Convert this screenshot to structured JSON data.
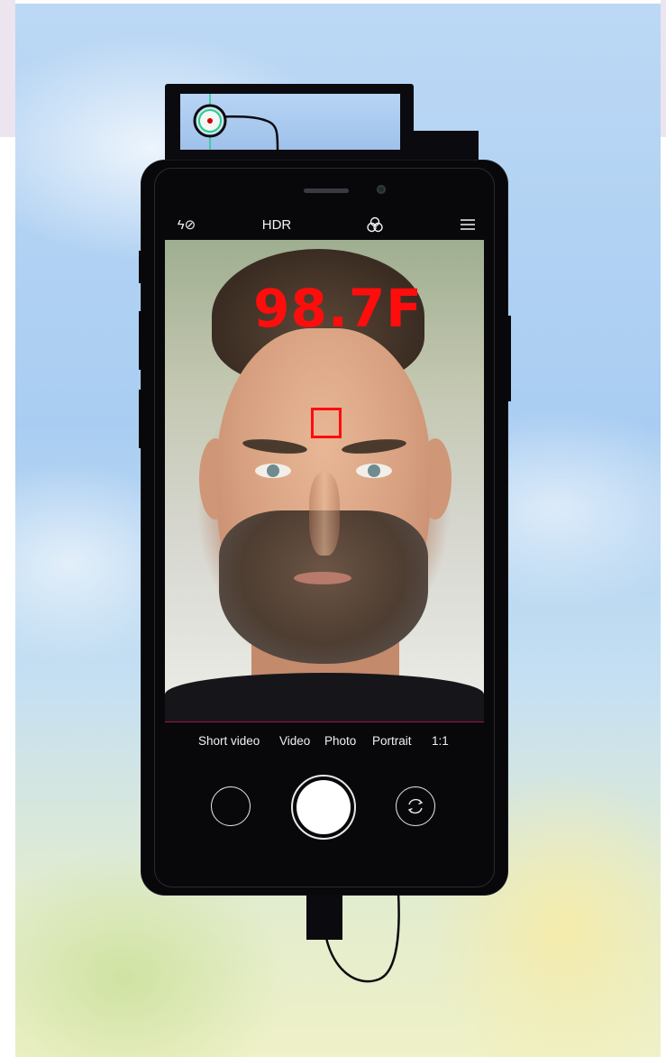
{
  "camera": {
    "top_bar": {
      "flash_label": "ϟ⊘",
      "hdr_label": "HDR",
      "filters_icon": "filters-icon",
      "menu_icon": "menu-icon"
    },
    "temperature_reading": "98.7F",
    "modes": [
      "Short video",
      "Video",
      "Photo",
      "Portrait",
      "1:1"
    ],
    "controls": {
      "gallery": "gallery-thumbnail",
      "shutter": "shutter-button",
      "switch_camera_icon": "switch-camera-icon"
    }
  },
  "colors": {
    "temperature": "#ff0d0d",
    "phone_body": "#08080b",
    "sensor_ring": "#1fd08a",
    "viewfinder_divider": "#a0154d"
  }
}
